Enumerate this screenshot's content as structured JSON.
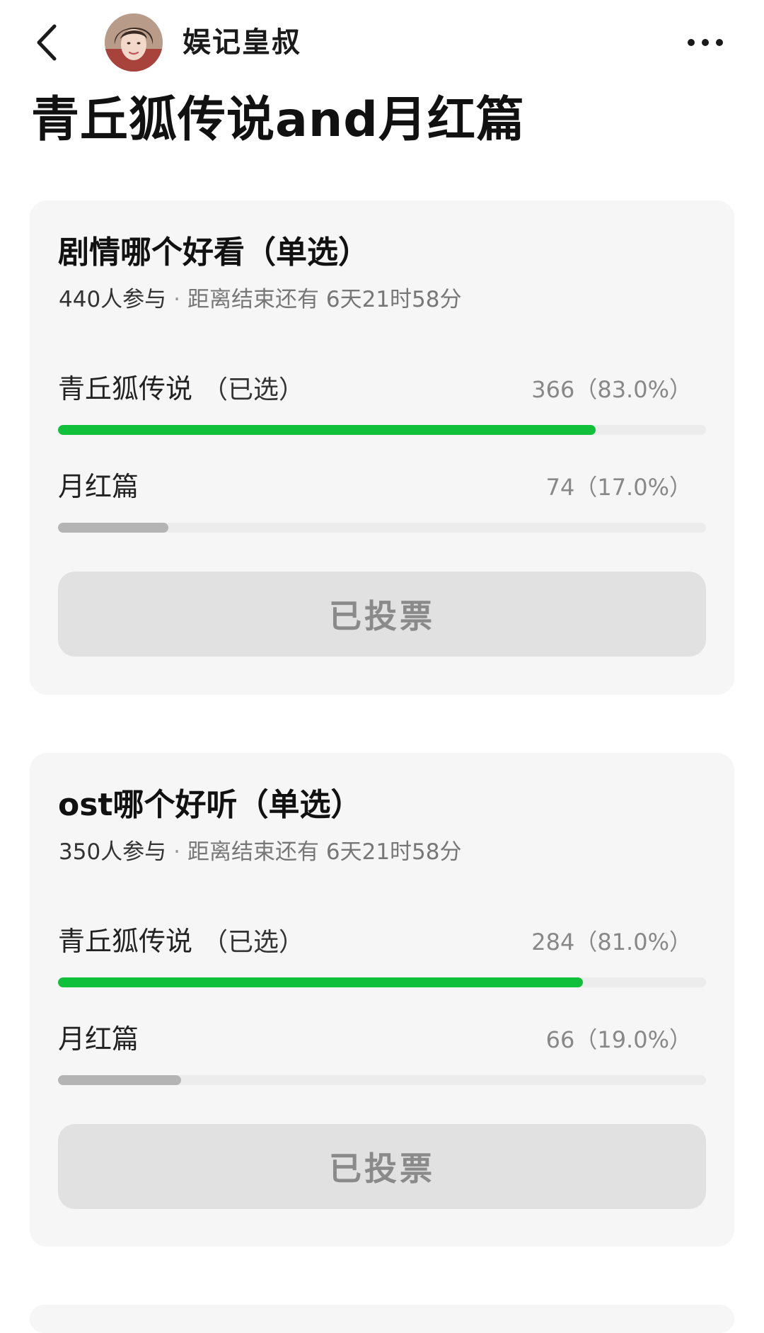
{
  "header": {
    "author_name": "娱记皇叔",
    "back_icon": "chevron-left-icon",
    "more_icon": "more-dots-icon"
  },
  "post": {
    "title": "青丘狐传说and月红篇"
  },
  "colors": {
    "winning_bar": "#10c03a",
    "losing_bar": "#b4b4b4",
    "card_bg": "#f6f6f6",
    "button_bg": "#e1e1e1"
  },
  "polls": [
    {
      "question": "剧情哪个好看（单选）",
      "participants": "440人参与",
      "separator": "·",
      "countdown": "距离结束还有 6天21时58分",
      "options": [
        {
          "label": "青丘狐传说",
          "selected_tag": "（已选）",
          "result": "366（83.0%）",
          "fraction": 0.83,
          "status": "winning"
        },
        {
          "label": "月红篇",
          "selected_tag": "",
          "result": "74（17.0%）",
          "fraction": 0.17,
          "status": "losing"
        }
      ],
      "button_label": "已投票"
    },
    {
      "question": "ost哪个好听（单选）",
      "participants": "350人参与",
      "separator": "·",
      "countdown": "距离结束还有 6天21时58分",
      "options": [
        {
          "label": "青丘狐传说",
          "selected_tag": "（已选）",
          "result": "284（81.0%）",
          "fraction": 0.81,
          "status": "winning"
        },
        {
          "label": "月红篇",
          "selected_tag": "",
          "result": "66（19.0%）",
          "fraction": 0.19,
          "status": "losing"
        }
      ],
      "button_label": "已投票"
    }
  ]
}
